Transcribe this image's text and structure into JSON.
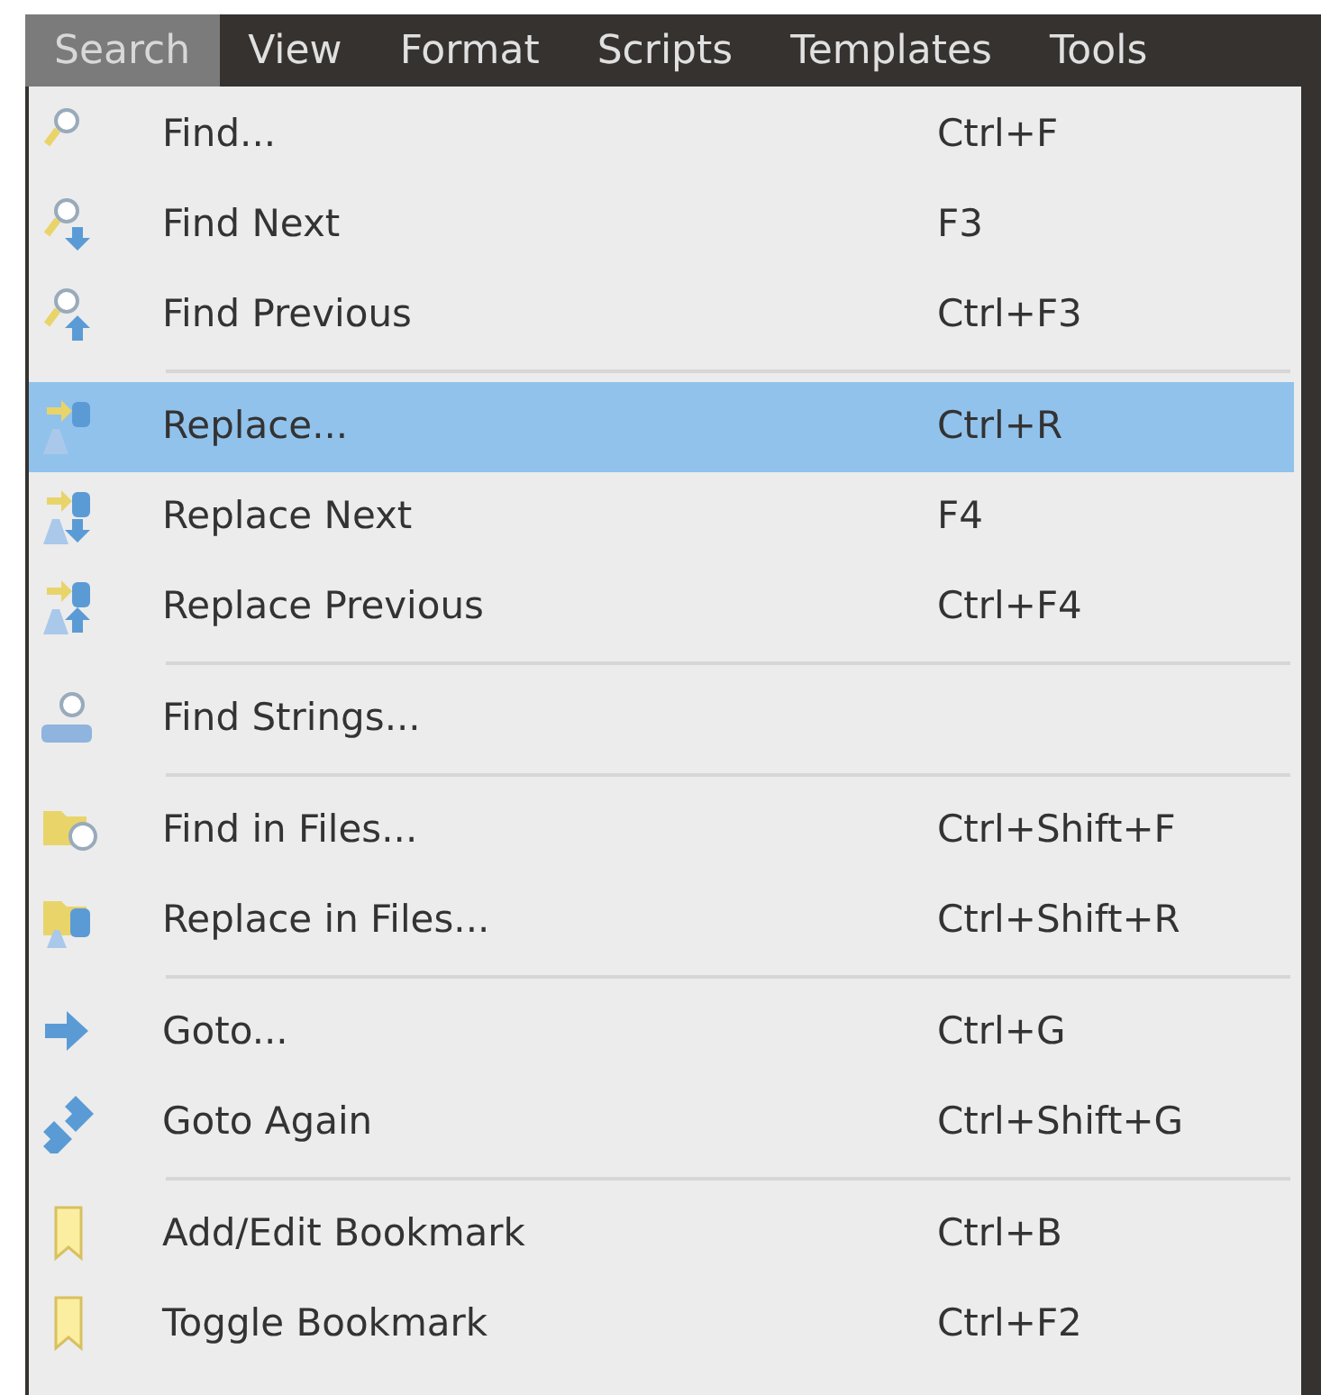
{
  "menubar": [
    {
      "label": "Search",
      "selected": true
    },
    {
      "label": "View",
      "selected": false
    },
    {
      "label": "Format",
      "selected": false
    },
    {
      "label": "Scripts",
      "selected": false
    },
    {
      "label": "Templates",
      "selected": false
    },
    {
      "label": "Tools",
      "selected": false
    }
  ],
  "menu": {
    "items": [
      {
        "kind": "item",
        "label": "Find...",
        "shortcut": "Ctrl+F",
        "selected": false
      },
      {
        "kind": "item",
        "label": "Find Next",
        "shortcut": "F3",
        "selected": false
      },
      {
        "kind": "item",
        "label": "Find Previous",
        "shortcut": "Ctrl+F3",
        "selected": false
      },
      {
        "kind": "separator"
      },
      {
        "kind": "item",
        "label": "Replace...",
        "shortcut": "Ctrl+R",
        "selected": true
      },
      {
        "kind": "item",
        "label": "Replace Next",
        "shortcut": "F4",
        "selected": false
      },
      {
        "kind": "item",
        "label": "Replace Previous",
        "shortcut": "Ctrl+F4",
        "selected": false
      },
      {
        "kind": "separator"
      },
      {
        "kind": "item",
        "label": "Find Strings...",
        "selected": false
      },
      {
        "kind": "separator"
      },
      {
        "kind": "item",
        "label": "Find in Files...",
        "shortcut": "Ctrl+Shift+F",
        "selected": false
      },
      {
        "kind": "item",
        "label": "Replace in Files...",
        "shortcut": "Ctrl+Shift+R",
        "selected": false
      },
      {
        "kind": "separator"
      },
      {
        "kind": "item",
        "label": "Goto...",
        "shortcut": "Ctrl+G",
        "selected": false
      },
      {
        "kind": "item",
        "label": "Goto Again",
        "shortcut": "Ctrl+Shift+G",
        "selected": false
      },
      {
        "kind": "separator"
      },
      {
        "kind": "item",
        "label": "Add/Edit Bookmark",
        "shortcut": "Ctrl+B",
        "selected": false
      },
      {
        "kind": "item",
        "label": "Toggle Bookmark",
        "shortcut": "Ctrl+F2",
        "selected": false
      }
    ]
  }
}
